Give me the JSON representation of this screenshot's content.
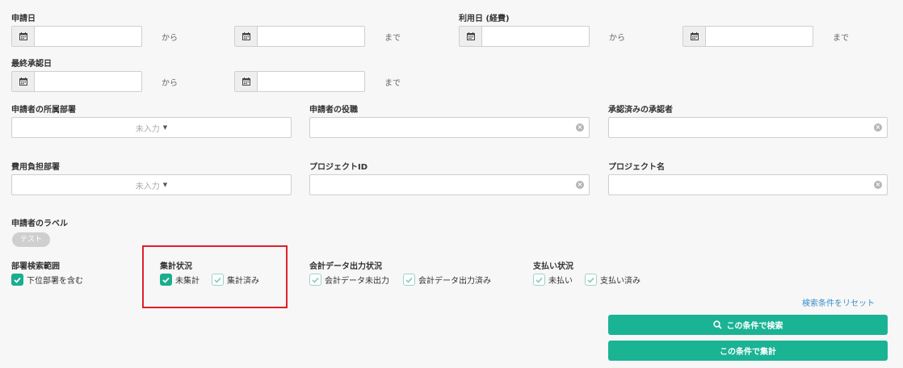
{
  "application_date": {
    "label": "申請日",
    "from": "から",
    "to": "まで"
  },
  "usage_date": {
    "label": "利用日 (経費)",
    "from": "から",
    "to": "まで"
  },
  "final_approval_date": {
    "label": "最終承認日",
    "from": "から",
    "to": "まで"
  },
  "applicant_department": {
    "label": "申請者の所属部署",
    "value": "未入力"
  },
  "applicant_position": {
    "label": "申請者の役職"
  },
  "approved_by": {
    "label": "承認済みの承認者"
  },
  "cost_department": {
    "label": "費用負担部署",
    "value": "未入力"
  },
  "project_id": {
    "label": "プロジェクトID"
  },
  "project_name": {
    "label": "プロジェクト名"
  },
  "applicant_label": {
    "label": "申請者のラベル",
    "tag": "テスト"
  },
  "dept_search_scope": {
    "label": "部署検索範囲",
    "options": [
      {
        "label": "下位部署を含む",
        "checked": true
      }
    ]
  },
  "aggregation_status": {
    "label": "集計状況",
    "options": [
      {
        "label": "未集計",
        "checked": true
      },
      {
        "label": "集計済み",
        "checked": false
      }
    ]
  },
  "accounting_export_status": {
    "label": "会計データ出力状況",
    "options": [
      {
        "label": "会計データ未出力",
        "checked": false
      },
      {
        "label": "会計データ出力済み",
        "checked": false
      }
    ]
  },
  "payment_status": {
    "label": "支払い状況",
    "options": [
      {
        "label": "未払い",
        "checked": false
      },
      {
        "label": "支払い済み",
        "checked": false
      }
    ]
  },
  "actions": {
    "reset": "検索条件をリセット",
    "search": "この条件で検索",
    "aggregate": "この条件で集計"
  },
  "colors": {
    "accent": "#1ab394",
    "highlight": "#e0202a",
    "link": "#3a8fc7"
  }
}
